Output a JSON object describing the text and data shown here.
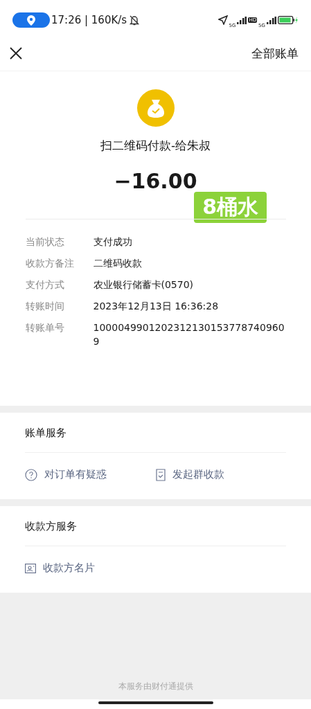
{
  "status_bar": {
    "time": "17:26 | 160K/s",
    "network_1": "5G",
    "hd": "HD",
    "network_2": "5G"
  },
  "nav": {
    "action": "全部账单"
  },
  "payment": {
    "title": "扫二维码付款-给朱叔",
    "amount": "−16.00",
    "sticker": "8桶水"
  },
  "details": [
    {
      "label": "当前状态",
      "value": "支付成功"
    },
    {
      "label": "收款方备注",
      "value": "二维码收款"
    },
    {
      "label": "支付方式",
      "value": "农业银行储蓄卡(0570)"
    },
    {
      "label": "转账时间",
      "value": "2023年12月13日 16:36:28"
    },
    {
      "label": "转账单号",
      "value": "10000499012023121301537787409609"
    }
  ],
  "sections": [
    {
      "title": "账单服务",
      "actions": [
        {
          "kind": "question",
          "label": "对订单有疑惑"
        },
        {
          "kind": "bill",
          "label": "发起群收款"
        }
      ]
    },
    {
      "title": "收款方服务",
      "actions": [
        {
          "kind": "card",
          "label": "收款方名片"
        }
      ]
    }
  ],
  "footer": "本服务由财付通提供"
}
